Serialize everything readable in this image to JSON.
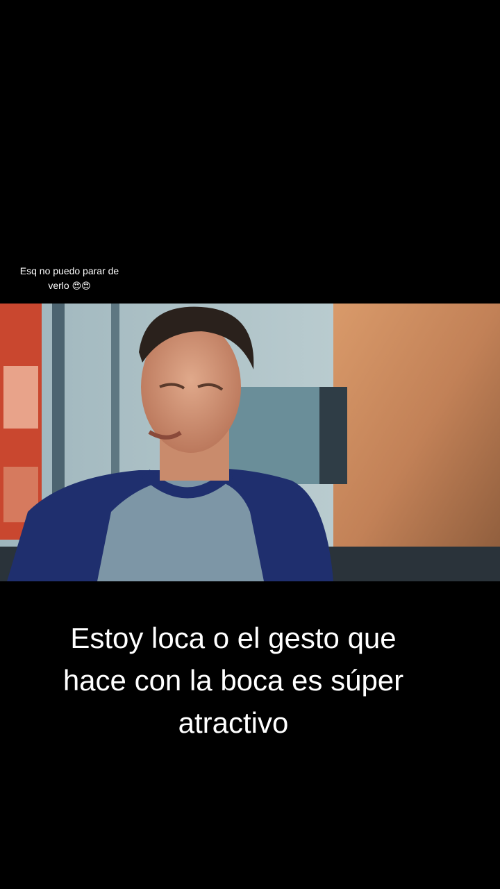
{
  "overlay_caption": {
    "line1": "Esq no puedo parar de",
    "line2": "verlo",
    "emoji": "😍😍"
  },
  "subtitle": {
    "line1": "Estoy loca o el gesto que",
    "line2": "hace con la boca es súper",
    "line3": "atractivo"
  },
  "colors": {
    "background": "#000000",
    "shirt_sleeves": "#1f2f6e",
    "shirt_body": "#7d96a6",
    "wall_wood": "#c28157",
    "left_menu_board": "#c9472f"
  }
}
